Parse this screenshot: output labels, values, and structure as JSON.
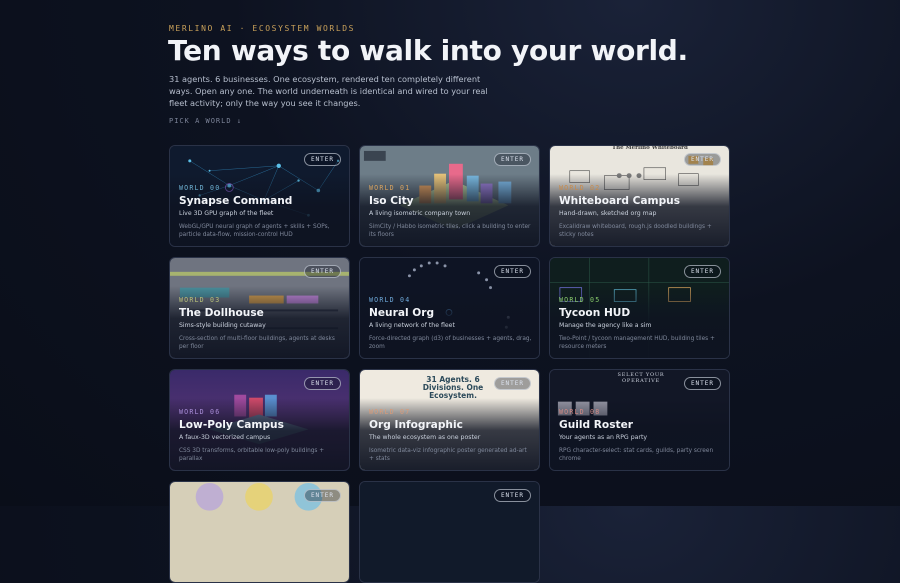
{
  "header": {
    "eyebrow": "MERLINO AI · ECOSYSTEM WORLDS",
    "title": "Ten ways to walk into your world.",
    "subtitle": "31 agents. 6 businesses. One ecosystem, rendered ten completely different ways. Open any one. The world underneath is identical and wired to your real fleet activity; only the way you see it changes.",
    "pick_label": "PICK A WORLD ↓"
  },
  "colors": {
    "background": "#0d1220",
    "eyebrow": "#c9a15a",
    "enter_border": "#dce2ee"
  },
  "worlds": [
    {
      "tag": "WORLD 00",
      "name": "Synapse Command",
      "tagline": "Live 3D GPU graph of the fleet",
      "desc": "WebGL/GPU neural graph of agents + skills + SOPs, particle data-flow, mission-control HUD",
      "enter": "ENTER"
    },
    {
      "tag": "WORLD 01",
      "name": "Iso City",
      "tagline": "A living isometric company town",
      "desc": "SimCity / Habbo isometric tiles, click a building to enter its floors",
      "enter": "ENTER"
    },
    {
      "tag": "WORLD 02",
      "name": "Whiteboard Campus",
      "tagline": "Hand-drawn, sketched org map",
      "desc": "Excalidraw whiteboard, rough.js doodled buildings + sticky notes",
      "enter": "ENTER",
      "art_title": "The Merlino Whiteboard"
    },
    {
      "tag": "WORLD 03",
      "name": "The Dollhouse",
      "tagline": "Sims-style building cutaway",
      "desc": "Cross-section of multi-floor buildings, agents at desks per floor",
      "enter": "ENTER"
    },
    {
      "tag": "WORLD 04",
      "name": "Neural Org",
      "tagline": "A living network of the fleet",
      "desc": "Force-directed graph (d3) of businesses + agents, drag, zoom",
      "enter": "ENTER"
    },
    {
      "tag": "WORLD 05",
      "name": "Tycoon HUD",
      "tagline": "Manage the agency like a sim",
      "desc": "Two-Point / tycoon management HUD, building tiles + resource meters",
      "enter": "ENTER"
    },
    {
      "tag": "WORLD 06",
      "name": "Low-Poly Campus",
      "tagline": "A faux-3D vectorized campus",
      "desc": "CSS 3D transforms, orbitable low-poly buildings + parallax",
      "enter": "ENTER"
    },
    {
      "tag": "WORLD 07",
      "name": "Org Infographic",
      "tagline": "The whole ecosystem as one poster",
      "desc": "Isometric data-viz infographic poster generated ad-art + stats",
      "enter": "ENTER",
      "art_title": "31 Agents. 6 Divisions. One Ecosystem."
    },
    {
      "tag": "WORLD 08",
      "name": "Guild Roster",
      "tagline": "Your agents as an RPG party",
      "desc": "RPG character-select: stat cards, guilds, party screen chrome",
      "enter": "ENTER",
      "art_title": "SELECT YOUR OPERATIVE"
    },
    {
      "tag": "",
      "name": "",
      "tagline": "",
      "desc": "",
      "enter": ""
    },
    {
      "tag": "",
      "name": "",
      "tagline": "",
      "desc": "",
      "enter": "ENTER"
    }
  ]
}
